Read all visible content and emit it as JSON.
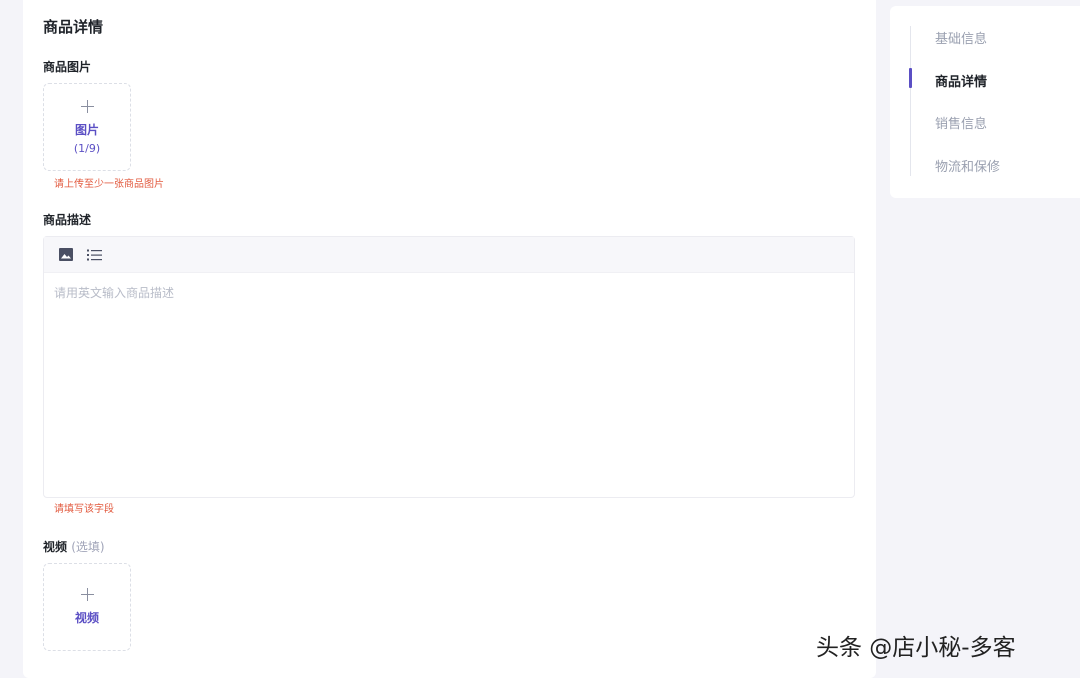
{
  "main": {
    "section_title": "商品详情",
    "images": {
      "label": "商品图片",
      "upload_label": "图片",
      "upload_count": "(1/9)",
      "error": "请上传至少一张商品图片"
    },
    "description": {
      "label": "商品描述",
      "toolbar": {
        "tools": [
          "image-icon",
          "bullet-list-icon"
        ]
      },
      "placeholder": "请用英文输入商品描述",
      "value": "",
      "error": "请填写该字段"
    },
    "video": {
      "label": "视频",
      "optional": "(选填)",
      "upload_label": "视频"
    }
  },
  "side_nav": {
    "items": [
      {
        "label": "基础信息",
        "active": false
      },
      {
        "label": "商品详情",
        "active": true
      },
      {
        "label": "销售信息",
        "active": false
      },
      {
        "label": "物流和保修",
        "active": false
      }
    ],
    "accent_color": "#5b4fc4"
  },
  "watermark": "头条 @店小秘-多客",
  "colors": {
    "accent": "#5b4fc4",
    "error": "#e25a3f",
    "background": "#f4f4f9"
  }
}
